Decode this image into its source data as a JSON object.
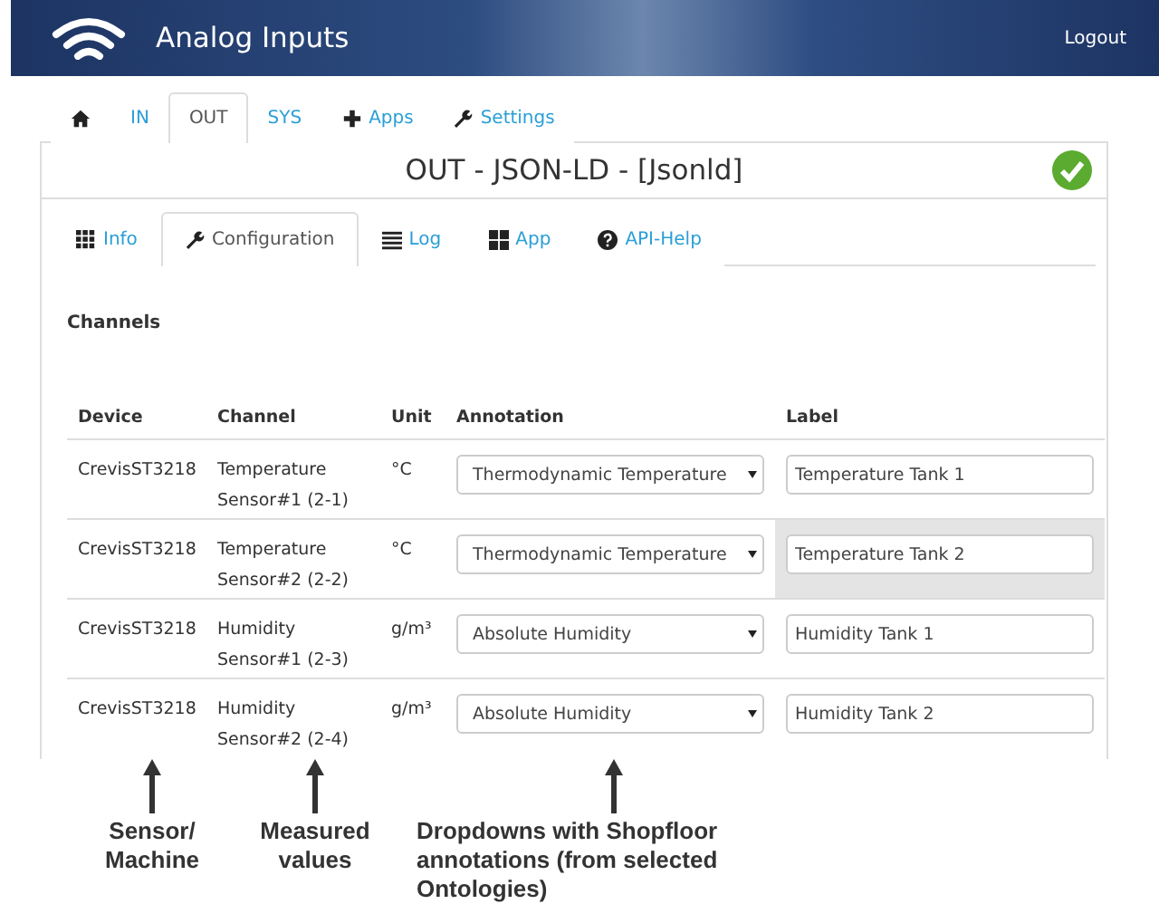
{
  "header": {
    "title": "Analog Inputs",
    "logout": "Logout"
  },
  "nav_tabs": [
    {
      "kind": "home",
      "selected": false
    },
    {
      "kind": "text",
      "label": "IN",
      "selected": false
    },
    {
      "kind": "text",
      "label": "OUT",
      "selected": true
    },
    {
      "kind": "text",
      "label": "SYS",
      "selected": false
    },
    {
      "kind": "plus",
      "label": "Apps",
      "selected": false
    },
    {
      "kind": "wrench",
      "label": "Settings",
      "selected": false
    }
  ],
  "panel": {
    "title": "OUT - JSON-LD - [Jsonld]",
    "status_ok": true,
    "tabs": [
      {
        "kind": "grid",
        "label": "Info",
        "selected": false
      },
      {
        "kind": "wrench",
        "label": "Configuration",
        "selected": true
      },
      {
        "kind": "list",
        "label": "Log",
        "selected": false
      },
      {
        "kind": "apps",
        "label": "App",
        "selected": false
      },
      {
        "kind": "help",
        "label": "API-Help",
        "selected": false
      }
    ],
    "section_title": "Channels",
    "table": {
      "columns": [
        "Device",
        "Channel",
        "Unit",
        "Annotation",
        "Label"
      ],
      "rows": [
        {
          "device": "CrevisST3218",
          "channel": "Temperature Sensor#1 (2-1)",
          "unit": "°C",
          "annotation": "Thermodynamic Temperature",
          "label": "Temperature Tank 1",
          "highlighted": false
        },
        {
          "device": "CrevisST3218",
          "channel": "Temperature Sensor#2 (2-2)",
          "unit": "°C",
          "annotation": "Thermodynamic Temperature",
          "label": "Temperature Tank 2",
          "highlighted": true
        },
        {
          "device": "CrevisST3218",
          "channel": "Humidity Sensor#1 (2-3)",
          "unit": "g/m³",
          "annotation": "Absolute Humidity",
          "label": "Humidity Tank 1",
          "highlighted": false
        },
        {
          "device": "CrevisST3218",
          "channel": "Humidity Sensor#2 (2-4)",
          "unit": "g/m³",
          "annotation": "Absolute Humidity",
          "label": "Humidity Tank 2",
          "highlighted": false
        }
      ]
    }
  },
  "callouts": [
    {
      "text": "Sensor/ Machine"
    },
    {
      "text": "Measured values"
    },
    {
      "text": "Dropdowns with Shopfloor annotations (from selected Ontologies)"
    }
  ]
}
